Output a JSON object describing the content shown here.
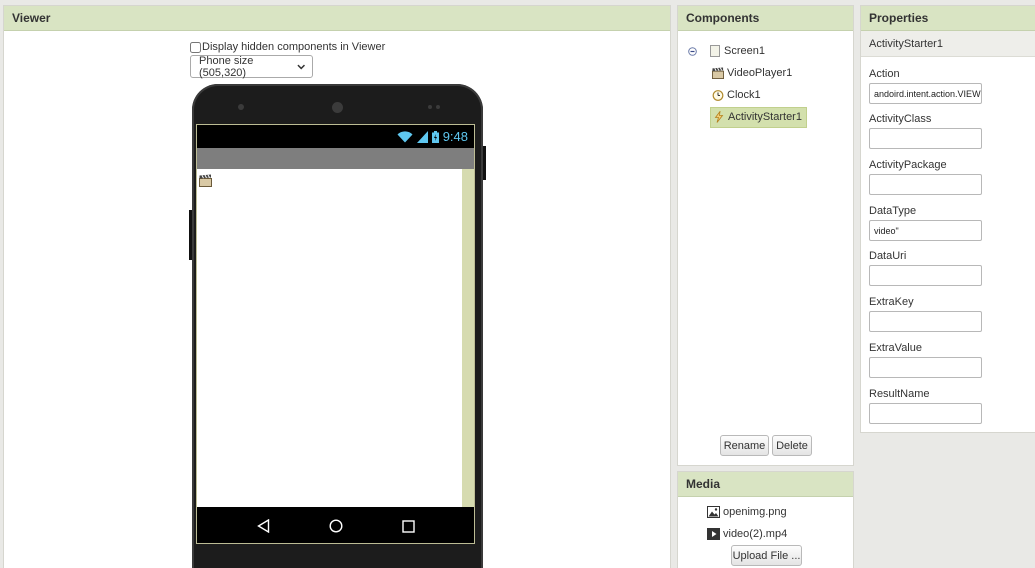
{
  "viewer": {
    "title": "Viewer",
    "hidden_checkbox_label": "Display hidden components in Viewer",
    "size_select": "Phone size (505,320)",
    "status_time": "9:48"
  },
  "components": {
    "title": "Components",
    "tree": {
      "root": "Screen1",
      "children": [
        "VideoPlayer1",
        "Clock1",
        "ActivityStarter1"
      ],
      "selected": "ActivityStarter1"
    },
    "rename_label": "Rename",
    "delete_label": "Delete"
  },
  "media": {
    "title": "Media",
    "files": [
      "openimg.png",
      "video(2).mp4"
    ],
    "upload_label": "Upload File ..."
  },
  "properties": {
    "title": "Properties",
    "component": "ActivityStarter1",
    "fields": [
      {
        "label": "Action",
        "value": "andoird.intent.action.VIEW"
      },
      {
        "label": "ActivityClass",
        "value": ""
      },
      {
        "label": "ActivityPackage",
        "value": ""
      },
      {
        "label": "DataType",
        "value": "video\""
      },
      {
        "label": "DataUri",
        "value": ""
      },
      {
        "label": "ExtraKey",
        "value": ""
      },
      {
        "label": "ExtraValue",
        "value": ""
      },
      {
        "label": "ResultName",
        "value": ""
      }
    ]
  },
  "colors": {
    "header_bg": "#d9e4c3",
    "selected_bg": "#d3e0ad",
    "status_icons": "#5fc7f0"
  }
}
